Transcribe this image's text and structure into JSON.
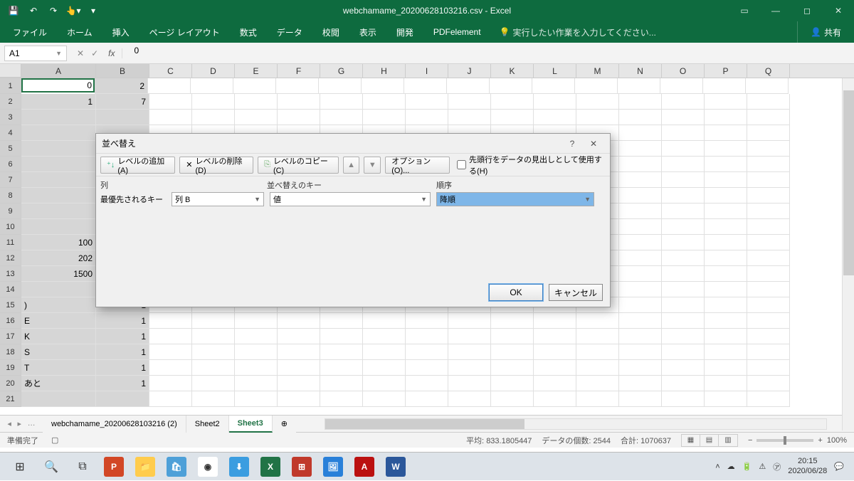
{
  "title": "webchamame_20200628103216.csv - Excel",
  "ribbon": {
    "tabs": [
      "ファイル",
      "ホーム",
      "挿入",
      "ページ レイアウト",
      "数式",
      "データ",
      "校閲",
      "表示",
      "開発",
      "PDFelement"
    ],
    "tellme": "実行したい作業を入力してください...",
    "share": "共有"
  },
  "namebox": "A1",
  "formula": "0",
  "columns": [
    "A",
    "B",
    "C",
    "D",
    "E",
    "F",
    "G",
    "H",
    "I",
    "J",
    "K",
    "L",
    "M",
    "N",
    "O",
    "P",
    "Q"
  ],
  "rows": {
    "1": {
      "A": "0",
      "B": "2"
    },
    "2": {
      "A": "1",
      "B": "7"
    },
    "3": {},
    "4": {},
    "5": {},
    "6": {},
    "7": {},
    "8": {},
    "9": {},
    "10": {},
    "11": {
      "A": "100"
    },
    "12": {
      "A": "202"
    },
    "13": {
      "A": "1500"
    },
    "14": {},
    "15": {
      "A": ")",
      "B": "1"
    },
    "16": {
      "A": "E",
      "B": "1"
    },
    "17": {
      "A": "K",
      "B": "1"
    },
    "18": {
      "A": "S",
      "B": "1"
    },
    "19": {
      "A": "T",
      "B": "1"
    },
    "20": {
      "A": "あと",
      "B": "1"
    }
  },
  "dialog": {
    "title": "並べ替え",
    "add_level": "レベルの追加(A)",
    "del_level": "レベルの削除(D)",
    "copy_level": "レベルのコピー(C)",
    "options": "オプション(O)...",
    "header_check": "先頭行をデータの見出しとして使用する(H)",
    "col_header": "列",
    "key_header": "並べ替えのキー",
    "order_header": "順序",
    "priority_label": "最優先されるキー",
    "col_value": "列 B",
    "key_value": "値",
    "order_value": "降順",
    "ok": "OK",
    "cancel": "キャンセル"
  },
  "sheets": {
    "tabs": [
      "webchamame_20200628103216 (2)",
      "Sheet2",
      "Sheet3"
    ],
    "active": 2
  },
  "status": {
    "ready": "準備完了",
    "avg_label": "平均:",
    "avg": "833.1805447",
    "count_label": "データの個数:",
    "count": "2544",
    "sum_label": "合計:",
    "sum": "1070637",
    "zoom": "100%"
  },
  "taskbar": {
    "time": "20:15",
    "date": "2020/06/28"
  }
}
